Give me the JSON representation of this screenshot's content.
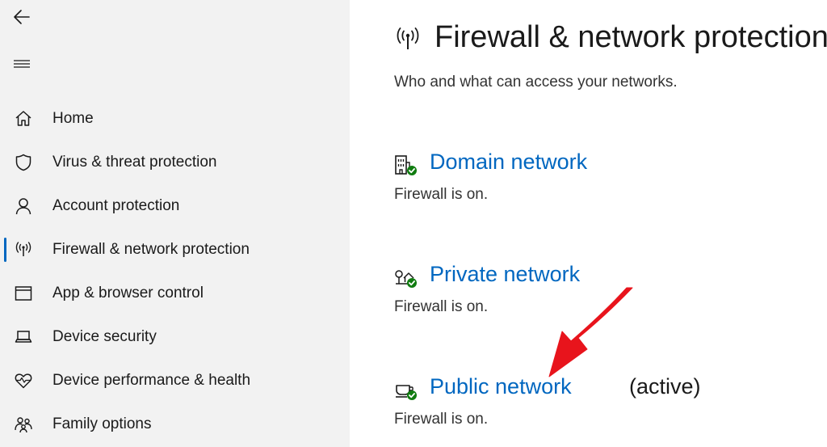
{
  "sidebar": {
    "back_icon": "back-arrow-icon",
    "menu_icon": "hamburger-menu-icon",
    "items": [
      {
        "label": "Home",
        "icon": "home-icon"
      },
      {
        "label": "Virus & threat protection",
        "icon": "shield-icon"
      },
      {
        "label": "Account protection",
        "icon": "person-icon"
      },
      {
        "label": "Firewall & network protection",
        "icon": "antenna-icon",
        "selected": true
      },
      {
        "label": "App & browser control",
        "icon": "browser-window-icon"
      },
      {
        "label": "Device security",
        "icon": "laptop-icon"
      },
      {
        "label": "Device performance & health",
        "icon": "heart-pulse-icon"
      },
      {
        "label": "Family options",
        "icon": "family-icon"
      }
    ]
  },
  "main": {
    "title": "Firewall & network protection",
    "title_icon": "antenna-icon",
    "subtitle": "Who and what can access your networks.",
    "networks": [
      {
        "name": "Domain network",
        "status": "Firewall is on.",
        "icon": "building-check-icon"
      },
      {
        "name": "Private network",
        "status": "Firewall is on.",
        "icon": "home-network-check-icon"
      },
      {
        "name": "Public network",
        "active_label": "(active)",
        "status": "Firewall is on.",
        "icon": "coffee-network-check-icon"
      }
    ]
  },
  "annotation": {
    "arrow_color": "#e8141c",
    "points_to": "Public network"
  },
  "colors": {
    "sidebar_bg": "#f2f2f2",
    "link": "#0067c0",
    "selection_bar": "#0067c0",
    "status_ok": "#107c10"
  }
}
